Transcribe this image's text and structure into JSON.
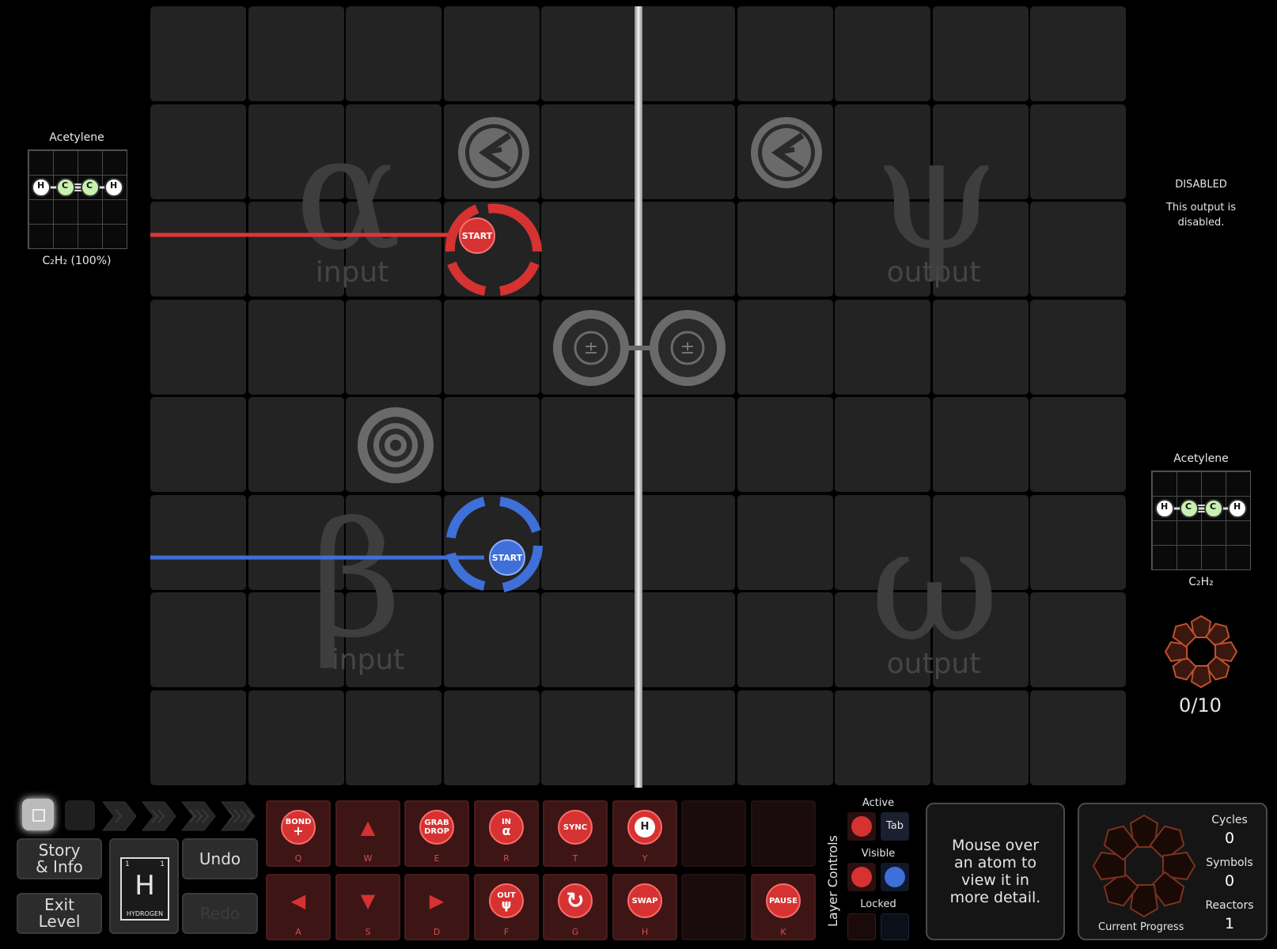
{
  "left_panel": {
    "input_molecule": {
      "name": "Acetylene",
      "formula": "C₂H₂ (100%)",
      "atoms": [
        "H",
        "C",
        "C",
        "H"
      ]
    }
  },
  "reactor": {
    "zones": {
      "alpha": {
        "glyph": "α",
        "label": "input"
      },
      "beta": {
        "glyph": "β",
        "label": "input"
      },
      "psi": {
        "glyph": "ψ",
        "label": "output"
      },
      "omega": {
        "glyph": "ω",
        "label": "output"
      }
    },
    "red_start_label": "START",
    "blue_start_label": "START"
  },
  "right_panel": {
    "status_title": "DISABLED",
    "status_text": "This output is disabled.",
    "output_molecule": {
      "name": "Acetylene",
      "formula": "C₂H₂",
      "atoms": [
        "H",
        "C",
        "C",
        "H"
      ]
    },
    "counter": "0/10"
  },
  "toolbar": {
    "story_info": "Story & Info",
    "exit_level": "Exit Level",
    "undo": "Undo",
    "redo": "Redo",
    "element": {
      "symbol": "H",
      "name": "HYDROGEN",
      "num_left": "1",
      "num_right": "1"
    },
    "instructions": [
      {
        "label": "BOND",
        "sub": "+",
        "key": "Q"
      },
      {
        "label": "▲",
        "sub": "",
        "key": "W"
      },
      {
        "label": "GRAB DROP",
        "sub": "",
        "key": "E"
      },
      {
        "label": "IN",
        "sub": "α",
        "key": "R"
      },
      {
        "label": "SYNC",
        "sub": "",
        "key": "T"
      },
      {
        "label": "H",
        "sub": "",
        "key": "Y"
      },
      {
        "label": "◀",
        "sub": "",
        "key": "A"
      },
      {
        "label": "▼",
        "sub": "",
        "key": "S"
      },
      {
        "label": "▶",
        "sub": "",
        "key": "D"
      },
      {
        "label": "OUT",
        "sub": "ψ",
        "key": "F"
      },
      {
        "label": "↻",
        "sub": "",
        "key": "G"
      },
      {
        "label": "SWAP",
        "sub": "",
        "key": "H"
      },
      {
        "label": "PAUSE",
        "sub": "",
        "key": "K"
      }
    ],
    "layer_controls": {
      "title": "Layer Controls",
      "active": "Active",
      "tab": "Tab",
      "visible": "Visible",
      "locked": "Locked"
    },
    "hover_hint": "Mouse over an atom to view it in more detail.",
    "progress": {
      "caption": "Current Progress",
      "cycles_label": "Cycles",
      "cycles": "0",
      "symbols_label": "Symbols",
      "symbols": "0",
      "reactors_label": "Reactors",
      "reactors": "1"
    }
  },
  "colors": {
    "red_waldo": "#d63232",
    "blue_waldo": "#3f6fd8",
    "carbon": "#c8f0b0",
    "background": "#000000",
    "cell": "#232323"
  }
}
